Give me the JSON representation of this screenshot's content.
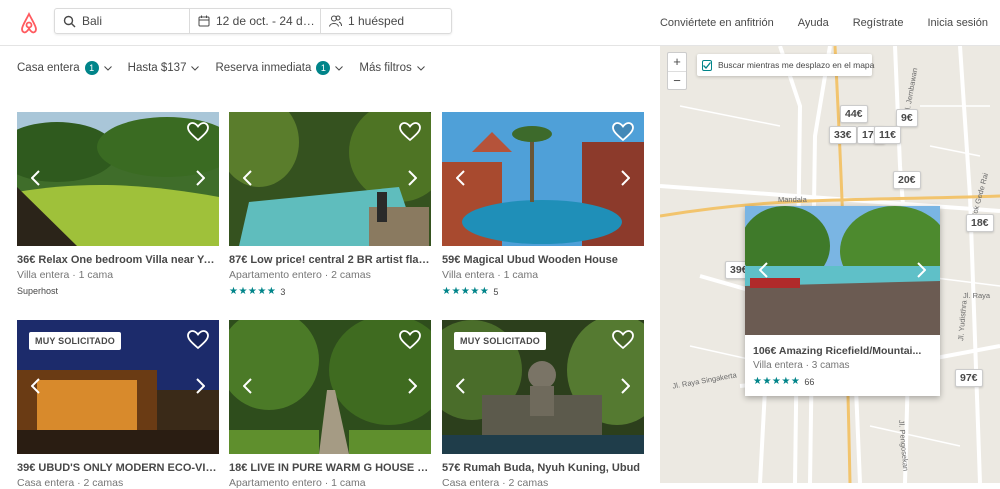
{
  "brand": {
    "accent": "#FF5A5F",
    "teal": "#008489"
  },
  "search": {
    "location": "Bali",
    "dates": "12 de oct. - 24 de o...",
    "guests": "1 huésped"
  },
  "nav": [
    "Conviértete en anfitrión",
    "Ayuda",
    "Regístrate",
    "Inicia sesión"
  ],
  "filters": [
    {
      "label": "Casa entera",
      "badge": "1"
    },
    {
      "label": "Hasta $137",
      "badge": ""
    },
    {
      "label": "Reserva inmediata",
      "badge": "1"
    },
    {
      "label": "Más filtros",
      "badge": ""
    }
  ],
  "listings": [
    {
      "title": "36€ Relax One bedroom Villa near Yog...",
      "sub": "Villa entera · 1 cama",
      "extra": "Superhost",
      "rating": "",
      "reviews": "",
      "tag": ""
    },
    {
      "title": "87€ Low price! central 2 BR artist flat ...",
      "sub": "Apartamento entero · 2 camas",
      "extra": "",
      "rating": "★★★★★",
      "reviews": "3",
      "tag": ""
    },
    {
      "title": "59€ Magical Ubud Wooden House",
      "sub": "Villa entera · 1 cama",
      "extra": "",
      "rating": "★★★★★",
      "reviews": "5",
      "tag": ""
    },
    {
      "title": "39€ UBUD'S ONLY MODERN ECO-VIL...",
      "sub": "Casa entera · 2 camas",
      "extra": "",
      "rating": "",
      "reviews": "",
      "tag": "MUY SOLICITADO"
    },
    {
      "title": "18€ LIVE IN PURE WARM G HOUSE 1B...",
      "sub": "Apartamento entero · 1 cama",
      "extra": "",
      "rating": "",
      "reviews": "",
      "tag": ""
    },
    {
      "title": "57€ Rumah Buda, Nyuh Kuning, Ubud",
      "sub": "Casa entera · 2 camas",
      "extra": "",
      "rating": "",
      "reviews": "",
      "tag": "MUY SOLICITADO"
    }
  ],
  "map": {
    "zoom_in": "+",
    "zoom_out": "−",
    "search_as_move": "Buscar mientras me desplazo en el mapa",
    "pins": [
      "44€",
      "9€",
      "33€",
      "17€",
      "11€",
      "20€",
      "18€",
      "39€",
      "97€"
    ],
    "labels": [
      "Mandala",
      "Jl. Raya Singakerta",
      "Jl. Jembawan",
      "Jl. Cok Gede Rai",
      "Jl. Yudisthra",
      "Jl. Pengosekan",
      "Jl. Raya"
    ],
    "popup": {
      "title": "106€ Amazing Ricefield/Mountai...",
      "sub": "Villa entera · 3 camas",
      "rating": "★★★★★",
      "reviews": "66"
    }
  }
}
